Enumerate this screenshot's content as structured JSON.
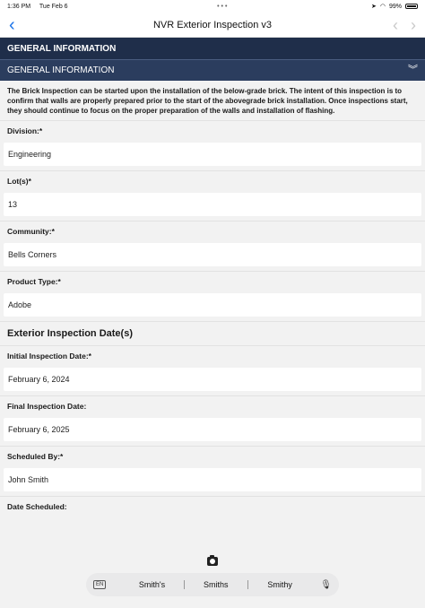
{
  "status_bar": {
    "time": "1:36 PM",
    "date": "Tue Feb 6",
    "dots": "•••",
    "battery": "99%"
  },
  "nav": {
    "back_icon": "chevron-left-icon",
    "title": "NVR Exterior Inspection v3"
  },
  "section": {
    "title": "GENERAL INFORMATION",
    "subsection": "GENERAL INFORMATION",
    "intro": "The Brick Inspection can be started upon the installation of the below-grade brick. The intent of this inspection is to confirm that walls are properly prepared prior to the start of the abovegrade brick installation. Once inspections start, they should continue to focus on the proper preparation of the walls and installation of flashing."
  },
  "fields": {
    "division": {
      "label": "Division:*",
      "value": "Engineering"
    },
    "lots": {
      "label": "Lot(s)*",
      "value": "13"
    },
    "community": {
      "label": "Community:*",
      "value": "Bells Corners"
    },
    "product_type": {
      "label": "Product Type:*",
      "value": "Adobe"
    }
  },
  "dates_group": {
    "heading": "Exterior Inspection Date(s)",
    "initial": {
      "label": "Initial Inspection Date:*",
      "value": "February 6, 2024"
    },
    "final": {
      "label": "Final Inspection Date:",
      "value": "February 6, 2025"
    },
    "scheduled_by": {
      "label": "Scheduled By:*",
      "value": "John Smith"
    },
    "date_scheduled": {
      "label": "Date Scheduled:"
    }
  },
  "keyboard": {
    "lang": "EN",
    "suggestions": [
      "Smith's",
      "Smiths",
      "Smithy"
    ]
  }
}
